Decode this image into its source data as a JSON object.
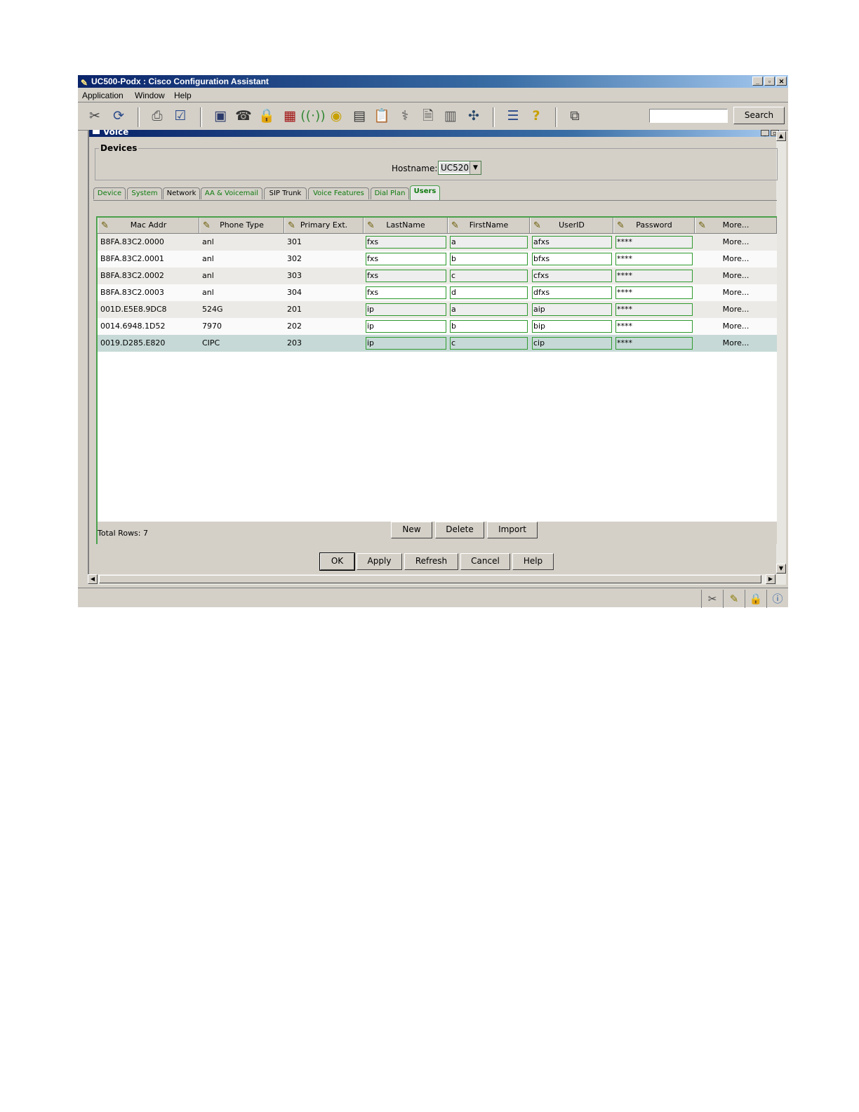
{
  "window": {
    "title": "UC500-Podx : Cisco Configuration Assistant",
    "minimize": "_",
    "restore": "▫",
    "close": "✕"
  },
  "menu": {
    "items": [
      "Application",
      "Window",
      "Help"
    ]
  },
  "toolbar": {
    "icons": [
      "disconnect-icon",
      "refresh-icon",
      "print-icon",
      "checklist-icon",
      "save-icon",
      "phone-icon",
      "security-icon",
      "firewall-icon",
      "wireless-icon",
      "bulb-icon",
      "monitor-settings-icon",
      "clipboard-icon",
      "diagnostics-icon",
      "document-icon",
      "server-icon",
      "topology-icon",
      "list-icon",
      "help-icon",
      "upgrade-icon"
    ],
    "search_value": "",
    "search_label": "Search"
  },
  "inner": {
    "title": "Voice"
  },
  "devices": {
    "label": "Devices",
    "hostname_label": "Hostname:",
    "hostname_value": "UC520"
  },
  "tabs": [
    "Device",
    "System",
    "Network",
    "AA & Voicemail",
    "SIP Trunk",
    "Voice Features",
    "Dial Plan",
    "Users"
  ],
  "active_tab": "Users",
  "table": {
    "columns": [
      "Mac Addr",
      "Phone Type",
      "Primary Ext.",
      "LastName",
      "FirstName",
      "UserID",
      "Password",
      "More..."
    ],
    "rows": [
      [
        "B8FA.83C2.0000",
        "anl",
        "301",
        "fxs",
        "a",
        "afxs",
        "****",
        "More..."
      ],
      [
        "B8FA.83C2.0001",
        "anl",
        "302",
        "fxs",
        "b",
        "bfxs",
        "****",
        "More..."
      ],
      [
        "B8FA.83C2.0002",
        "anl",
        "303",
        "fxs",
        "c",
        "cfxs",
        "****",
        "More..."
      ],
      [
        "B8FA.83C2.0003",
        "anl",
        "304",
        "fxs",
        "d",
        "dfxs",
        "****",
        "More..."
      ],
      [
        "001D.E5E8.9DC8",
        "524G",
        "201",
        "ip",
        "a",
        "aip",
        "****",
        "More..."
      ],
      [
        "0014.6948.1D52",
        "7970",
        "202",
        "ip",
        "b",
        "bip",
        "****",
        "More..."
      ],
      [
        "0019.D285.E820",
        "CIPC",
        "203",
        "ip",
        "c",
        "cip",
        "****",
        "More..."
      ]
    ],
    "selected_row": 6,
    "total_rows": "Total Rows: 7",
    "buttons": {
      "new": "New",
      "delete": "Delete",
      "import": "Import"
    }
  },
  "dialog_buttons": {
    "ok": "OK",
    "apply": "Apply",
    "refresh": "Refresh",
    "cancel": "Cancel",
    "help": "Help"
  },
  "colors": {
    "accent_green": "#0f7a0f",
    "title_blue": "#0a246a",
    "selected_row": "#c6d9d6"
  }
}
